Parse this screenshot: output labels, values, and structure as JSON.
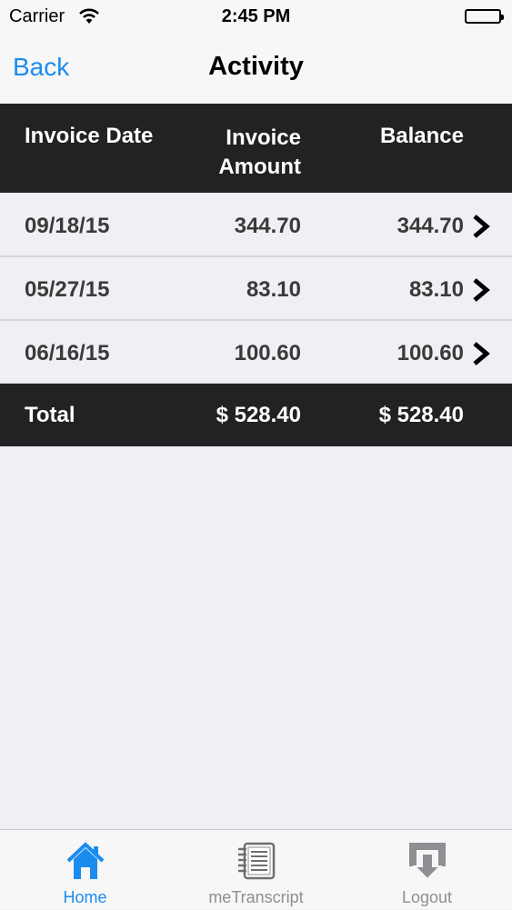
{
  "status_bar": {
    "carrier": "Carrier",
    "time": "2:45 PM"
  },
  "nav": {
    "back_label": "Back",
    "title": "Activity"
  },
  "table": {
    "headers": {
      "date": "Invoice Date",
      "amount_line1": "Invoice",
      "amount_line2": "Amount",
      "balance": "Balance"
    },
    "rows": [
      {
        "date": "09/18/15",
        "amount": "344.70",
        "balance": "344.70"
      },
      {
        "date": "05/27/15",
        "amount": "83.10",
        "balance": "83.10"
      },
      {
        "date": "06/16/15",
        "amount": "100.60",
        "balance": "100.60"
      }
    ],
    "total": {
      "label": "Total",
      "amount": "$ 528.40",
      "balance": "$ 528.40"
    }
  },
  "tab_bar": {
    "tabs": [
      {
        "label": "Home",
        "icon": "home-icon",
        "active": true
      },
      {
        "label": "meTranscript",
        "icon": "notebook-icon",
        "active": false
      },
      {
        "label": "Logout",
        "icon": "logout-icon",
        "active": false
      }
    ]
  },
  "colors": {
    "accent": "#1a8cf0",
    "header_bg": "#222123",
    "background": "#efeff4",
    "row_text": "#3a3a3a"
  }
}
